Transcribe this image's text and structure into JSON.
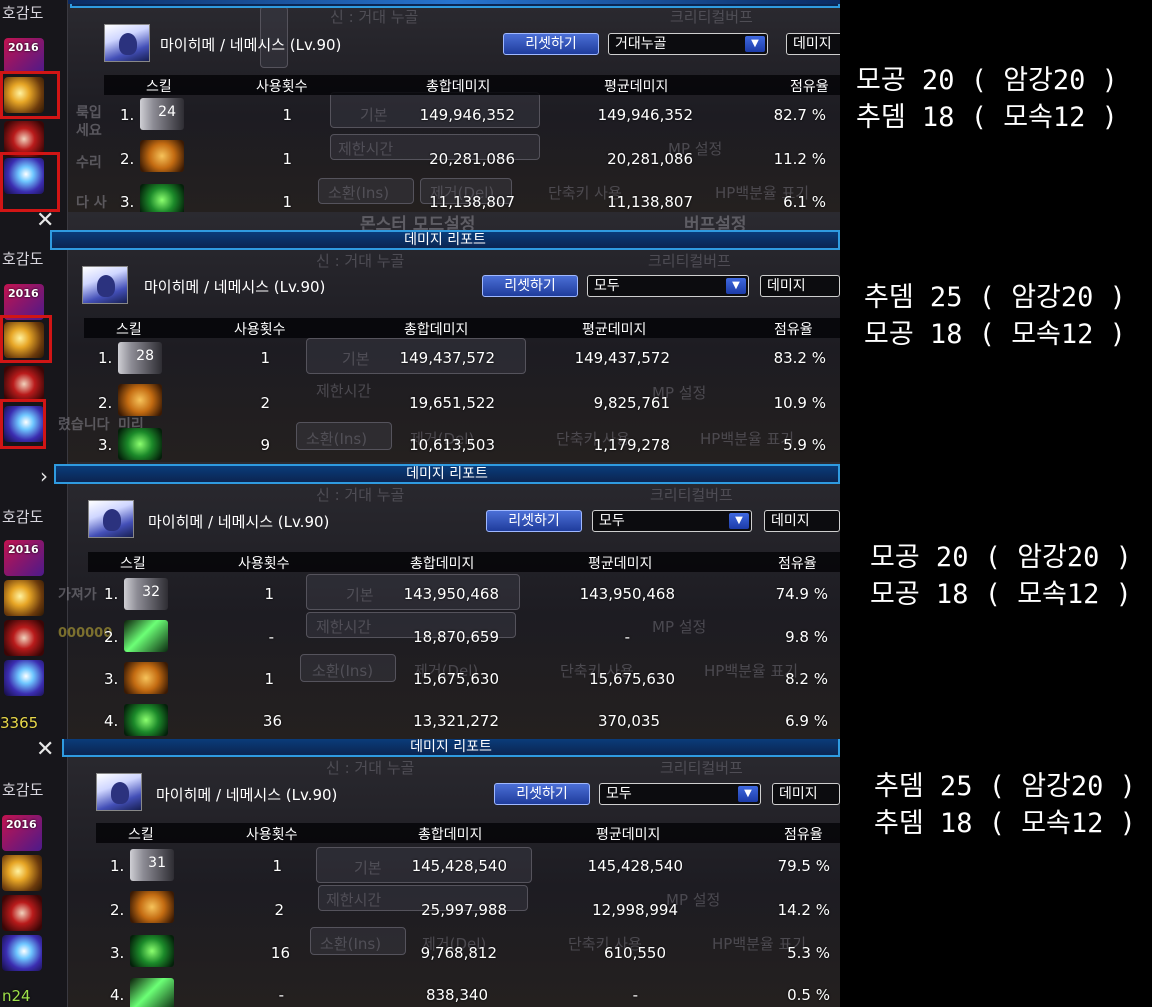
{
  "common": {
    "title": "데미지 리포트",
    "char_name": "마이히메 / 네메시스 (Lv.90)",
    "reset_label": "리셋하기",
    "dmg_label": "데미지",
    "close_glyph": "✕",
    "hogam_label": "호감도",
    "header": {
      "skill": "스킬",
      "count": "사용횟수",
      "total": "총합데미지",
      "avg": "평균데미지",
      "share": "점유율"
    },
    "bg": {
      "god": "신 : 거대 누골",
      "crit": "크리티컬버프",
      "basic": "기본",
      "limit": "제한시간",
      "mp": "MP 설정",
      "summon": "소환(Ins)",
      "remove": "제거(Del)",
      "shortcut": "단축키 사용",
      "hp": "HP백분율 표기",
      "monster_mode": "몬스터 모드설정",
      "buff": "버프설정",
      "setting": "설정"
    },
    "left_text": {
      "p1a": "룩입",
      "p1b": "세요",
      "p1c": "수리",
      "p1d": "다 사",
      "p2a": "렸습니다",
      "p2b": "미리",
      "p3a": "가져가",
      "p3b": "000000",
      "p3c": "3365",
      "p4a": "n24"
    },
    "icon_2016_label": "2016"
  },
  "panels": [
    {
      "filter": "거대누골",
      "rows": [
        {
          "idx": "1.",
          "icon": "base",
          "icon_num": "24",
          "count": "1",
          "total": "149,946,352",
          "avg": "149,946,352",
          "share": "82.7 %"
        },
        {
          "idx": "2.",
          "icon": "orange",
          "icon_num": "",
          "count": "1",
          "total": "20,281,086",
          "avg": "20,281,086",
          "share": "11.2 %"
        },
        {
          "idx": "3.",
          "icon": "green",
          "icon_num": "",
          "count": "1",
          "total": "11,138,807",
          "avg": "11,138,807",
          "share": "6.1 %"
        }
      ],
      "note": [
        "모공 20 ( 암강20 )",
        "추뎀 18 ( 모속12 )"
      ]
    },
    {
      "filter": "모두",
      "rows": [
        {
          "idx": "1.",
          "icon": "base",
          "icon_num": "28",
          "count": "1",
          "total": "149,437,572",
          "avg": "149,437,572",
          "share": "83.2 %"
        },
        {
          "idx": "2.",
          "icon": "orange",
          "icon_num": "",
          "count": "2",
          "total": "19,651,522",
          "avg": "9,825,761",
          "share": "10.9 %"
        },
        {
          "idx": "3.",
          "icon": "green",
          "icon_num": "",
          "count": "9",
          "total": "10,613,503",
          "avg": "1,179,278",
          "share": "5.9 %"
        }
      ],
      "note": [
        "추뎀 25 ( 암강20 )",
        "모공 18 ( 모속12 )"
      ]
    },
    {
      "filter": "모두",
      "rows": [
        {
          "idx": "1.",
          "icon": "base",
          "icon_num": "32",
          "count": "1",
          "total": "143,950,468",
          "avg": "143,950,468",
          "share": "74.9 %"
        },
        {
          "idx": "2.",
          "icon": "lime",
          "icon_num": "",
          "count": "-",
          "total": "18,870,659",
          "avg": "-",
          "share": "9.8 %"
        },
        {
          "idx": "3.",
          "icon": "orange",
          "icon_num": "",
          "count": "1",
          "total": "15,675,630",
          "avg": "15,675,630",
          "share": "8.2 %"
        },
        {
          "idx": "4.",
          "icon": "green",
          "icon_num": "",
          "count": "36",
          "total": "13,321,272",
          "avg": "370,035",
          "share": "6.9 %"
        }
      ],
      "note": [
        "모공 20 ( 암강20 )",
        "모공 18 ( 모속12 )"
      ]
    },
    {
      "filter": "모두",
      "rows": [
        {
          "idx": "1.",
          "icon": "base",
          "icon_num": "31",
          "count": "1",
          "total": "145,428,540",
          "avg": "145,428,540",
          "share": "79.5 %"
        },
        {
          "idx": "2.",
          "icon": "orange",
          "icon_num": "",
          "count": "2",
          "total": "25,997,988",
          "avg": "12,998,994",
          "share": "14.2 %"
        },
        {
          "idx": "3.",
          "icon": "green",
          "icon_num": "",
          "count": "16",
          "total": "9,768,812",
          "avg": "610,550",
          "share": "5.3 %"
        },
        {
          "idx": "4.",
          "icon": "lime",
          "icon_num": "",
          "count": "-",
          "total": "838,340",
          "avg": "-",
          "share": "0.5 %"
        }
      ],
      "note": [
        "추뎀 25 ( 암강20 )",
        "추뎀 18 ( 모속12 )"
      ]
    }
  ],
  "colors": {
    "highlight": "#d11515",
    "title_bar": "#0a3c7a",
    "reset_button": "#3b5fc9"
  }
}
